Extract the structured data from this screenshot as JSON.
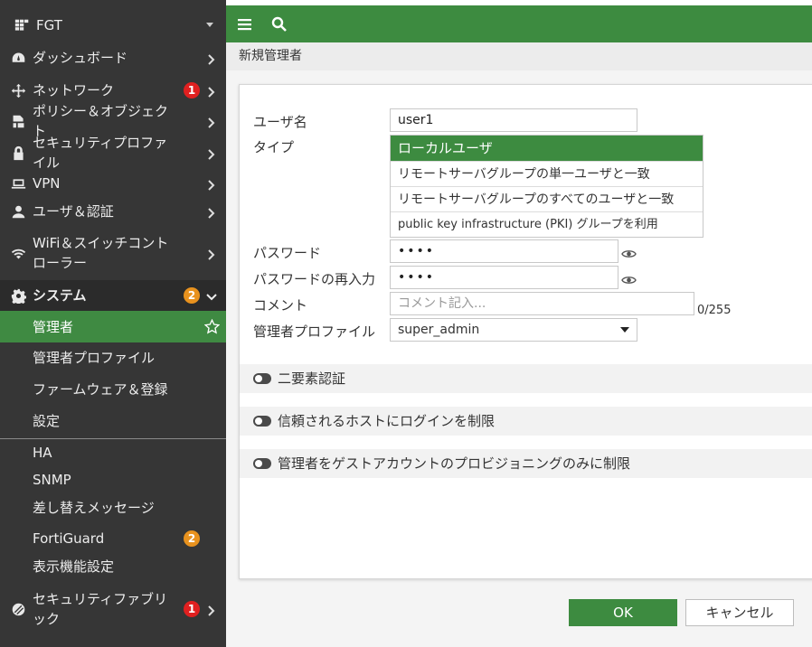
{
  "sidebar": {
    "device": "FGT",
    "items": [
      {
        "label": "ダッシュボード",
        "icon": "dashboard-icon"
      },
      {
        "label": "ネットワーク",
        "icon": "network-icon",
        "badge": "1"
      },
      {
        "label": "ポリシー＆オブジェクト",
        "icon": "policy-icon"
      },
      {
        "label": "セキュリティプロファイル",
        "icon": "lock-icon"
      },
      {
        "label": "VPN",
        "icon": "laptop-icon"
      },
      {
        "label": "ユーザ＆認証",
        "icon": "user-icon"
      },
      {
        "label": "WiFi＆スイッチコントローラー",
        "icon": "wifi-icon"
      },
      {
        "label": "システム",
        "icon": "gear-icon",
        "badge": "2"
      }
    ],
    "system_sub": [
      {
        "label": "管理者"
      },
      {
        "label": "管理者プロファイル"
      },
      {
        "label": "ファームウェア＆登録"
      },
      {
        "label": "設定"
      },
      {
        "label": "HA"
      },
      {
        "label": "SNMP"
      },
      {
        "label": "差し替えメッセージ"
      },
      {
        "label": "FortiGuard",
        "badge": "2"
      },
      {
        "label": "表示機能設定"
      }
    ],
    "fabric": {
      "label": "セキュリティファブリック",
      "badge": "1"
    }
  },
  "breadcrumb": "新規管理者",
  "form": {
    "username_label": "ユーザ名",
    "username_value": "user1",
    "type_label": "タイプ",
    "type_options": [
      "ローカルユーザ",
      "リモートサーバグループの単一ユーザと一致",
      "リモートサーバグループのすべてのユーザと一致",
      "public key infrastructure (PKI) グループを利用"
    ],
    "type_selected": "ローカルユーザ",
    "password_label": "パスワード",
    "password_value": "••••",
    "password_confirm_label": "パスワードの再入力",
    "password_confirm_value": "••••",
    "comment_label": "コメント",
    "comment_placeholder": "コメント記入...",
    "comment_counter": "0/255",
    "profile_label": "管理者プロファイル",
    "profile_value": "super_admin",
    "toggles": [
      "二要素認証",
      "信頼されるホストにログインを制限",
      "管理者をゲストアカウントのプロビジョニングのみに制限"
    ]
  },
  "buttons": {
    "ok": "OK",
    "cancel": "キャンセル"
  },
  "colors": {
    "accent": "#3d8b40",
    "sidebar": "#363636",
    "badge_red": "#e02020",
    "badge_orange": "#e8921e"
  }
}
